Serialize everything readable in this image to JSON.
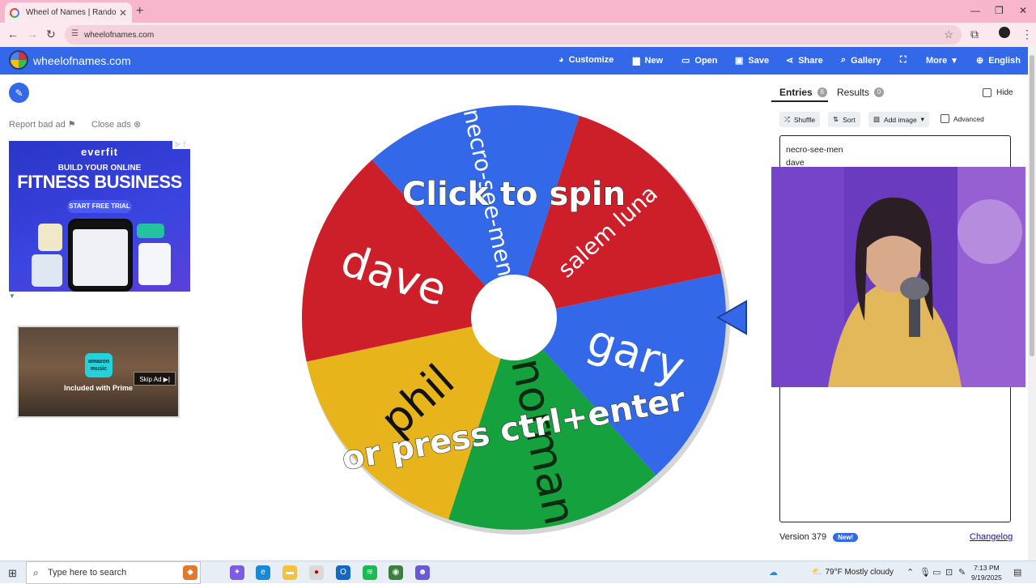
{
  "browser": {
    "tab_title": "Wheel of Names | Random nan",
    "new_tab": "+",
    "url": "wheelofnames.com"
  },
  "site": {
    "brand": "wheelofnames.com",
    "nav": {
      "customize": "Customize",
      "new": "New",
      "open": "Open",
      "save": "Save",
      "share": "Share",
      "gallery": "Gallery",
      "more": "More",
      "language": "English"
    }
  },
  "ads": {
    "report": "Report bad ad",
    "close": "Close ads",
    "ad1": {
      "brand": "everfit",
      "line1": "BUILD YOUR ONLINE",
      "line2": "FITNESS BUSINESS",
      "cta": "START FREE TRIAL"
    },
    "ad2": {
      "logo": "amazon music",
      "caption": "Included with Prime",
      "skip": "Skip Ad"
    }
  },
  "wheel": {
    "overlay_line1": "Click to spin",
    "overlay_line2": "or press ctrl+enter",
    "segments": [
      {
        "name": "salem luna",
        "color": "#cc1f2a"
      },
      {
        "name": "gary",
        "color": "#3369e8"
      },
      {
        "name": "norman",
        "color": "#14a13e"
      },
      {
        "name": "phil",
        "color": "#e7b51b"
      },
      {
        "name": "dave",
        "color": "#cc1f2a"
      },
      {
        "name": "necro-see-men",
        "color": "#3369e8"
      }
    ]
  },
  "panel": {
    "tab_entries": "Entries",
    "entries_count": "6",
    "tab_results": "Results",
    "results_count": "0",
    "hide": "Hide",
    "shuffle": "Shuffle",
    "sort": "Sort",
    "add_image": "Add image",
    "advanced": "Advanced",
    "entries": [
      "necro-see-men",
      "dave"
    ],
    "version": "Version 379",
    "new_badge": "New!",
    "changelog": "Changelog"
  },
  "taskbar": {
    "search_placeholder": "Type here to search",
    "weather": "79°F  Mostly cloudy",
    "time": "7:13 PM",
    "date": "9/19/2025"
  }
}
